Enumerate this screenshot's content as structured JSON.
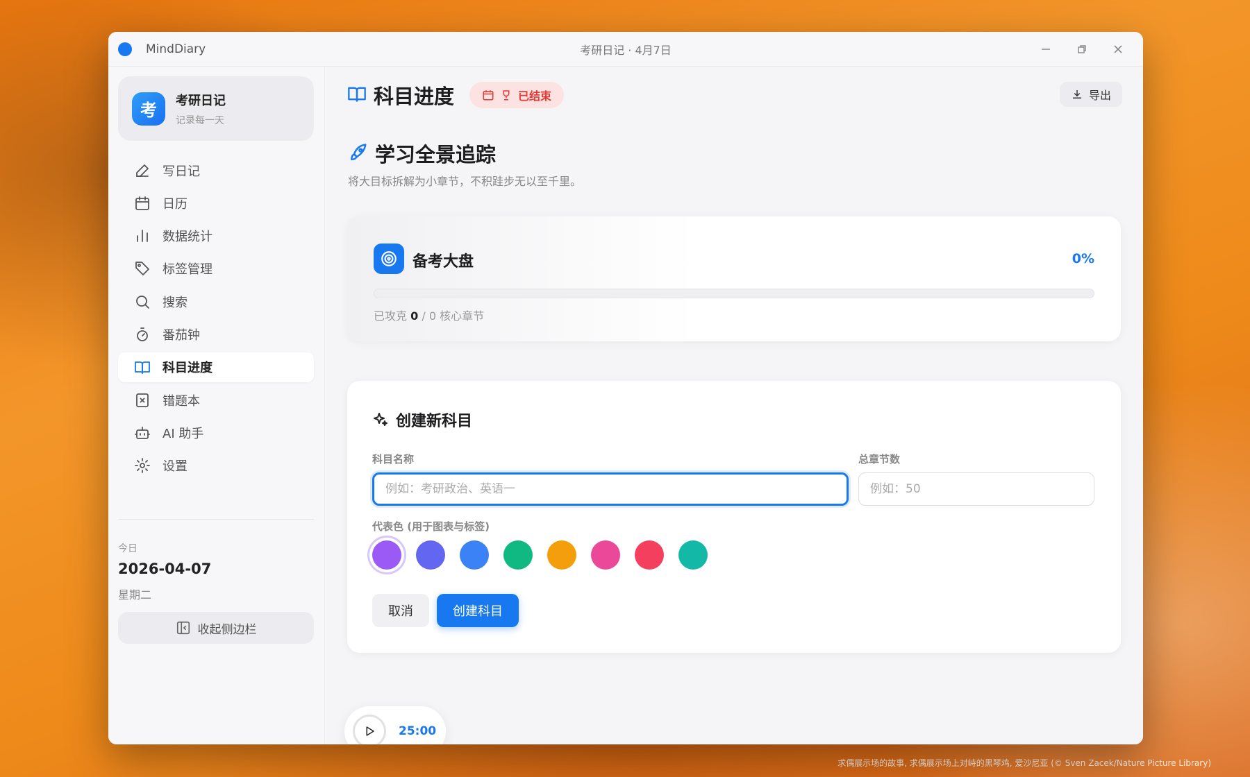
{
  "window": {
    "app_name": "MindDiary",
    "title": "考研日记 · 4月7日",
    "controls": {
      "minimize": "—",
      "maximize": "◻",
      "close": "✕"
    }
  },
  "sidebar": {
    "brand": {
      "logo_char": "考",
      "title": "考研日记",
      "subtitle": "记录每一天"
    },
    "items": [
      {
        "label": "写日记",
        "icon": "pen-icon",
        "active": false
      },
      {
        "label": "日历",
        "icon": "calendar-icon",
        "active": false
      },
      {
        "label": "数据统计",
        "icon": "bar-chart-icon",
        "active": false
      },
      {
        "label": "标签管理",
        "icon": "tag-icon",
        "active": false
      },
      {
        "label": "搜索",
        "icon": "search-icon",
        "active": false
      },
      {
        "label": "番茄钟",
        "icon": "timer-icon",
        "active": false
      },
      {
        "label": "科目进度",
        "icon": "book-open-icon",
        "active": true
      },
      {
        "label": "错题本",
        "icon": "notebook-x-icon",
        "active": false
      },
      {
        "label": "AI 助手",
        "icon": "robot-icon",
        "active": false
      },
      {
        "label": "设置",
        "icon": "gear-icon",
        "active": false
      }
    ],
    "today": {
      "label": "今日",
      "date": "2026-04-07",
      "weekday": "星期二"
    },
    "collapse_label": "收起侧边栏"
  },
  "header": {
    "title": "科目进度",
    "status_badge": "已结束",
    "export_label": "导出"
  },
  "overview": {
    "section_title": "学习全景追踪",
    "section_subtitle": "将大目标拆解为小章节，不积跬步无以至千里。",
    "card_title": "备考大盘",
    "percent": "0%",
    "progress_fraction": 0,
    "stat_prefix": "已攻克",
    "completed": "0",
    "stat_suffix": "/ 0 核心章节"
  },
  "create_form": {
    "title": "创建新科目",
    "name_label": "科目名称",
    "name_placeholder": "例如：考研政治、英语一",
    "name_value": "",
    "chapters_label": "总章节数",
    "chapters_placeholder": "例如：50",
    "chapters_value": "",
    "color_label": "代表色 (用于图表与标签)",
    "colors": [
      "#9b59f6",
      "#6366f1",
      "#3b82f6",
      "#10b981",
      "#f59e0b",
      "#ec4899",
      "#f43f5e",
      "#14b8a6"
    ],
    "selected_color_index": 0,
    "cancel_label": "取消",
    "submit_label": "创建科目"
  },
  "pomodoro": {
    "time": "25:00"
  },
  "colors": {
    "accent": "#1878f0",
    "danger": "#e53935"
  },
  "wallpaper_credit": "求偶展示场的故事, 求偶展示场上对峙的黑琴鸡, 爱沙尼亚 (© Sven Zacek/Nature Picture Library)"
}
